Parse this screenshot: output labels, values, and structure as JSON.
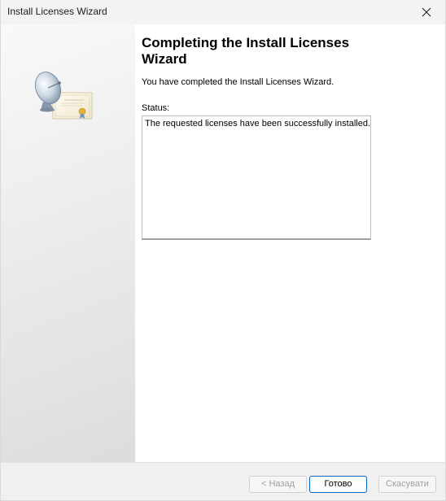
{
  "window": {
    "title": "Install Licenses Wizard",
    "close_label": "✕"
  },
  "content": {
    "heading": "Completing the Install Licenses Wizard",
    "description": "You have completed the Install Licenses Wizard.",
    "status_label": "Status:",
    "status_text": "The requested licenses have been successfully installed."
  },
  "footer": {
    "back_label": "< Назад",
    "finish_label": "Готово",
    "cancel_label": "Скасувати"
  },
  "colors": {
    "accent": "#0067c0",
    "titlebar": "#f3f3f3",
    "footer": "#f0f0f0"
  },
  "icons": {
    "sidebar_art": "satellite-dish-certificate-icon",
    "close": "close-icon"
  }
}
